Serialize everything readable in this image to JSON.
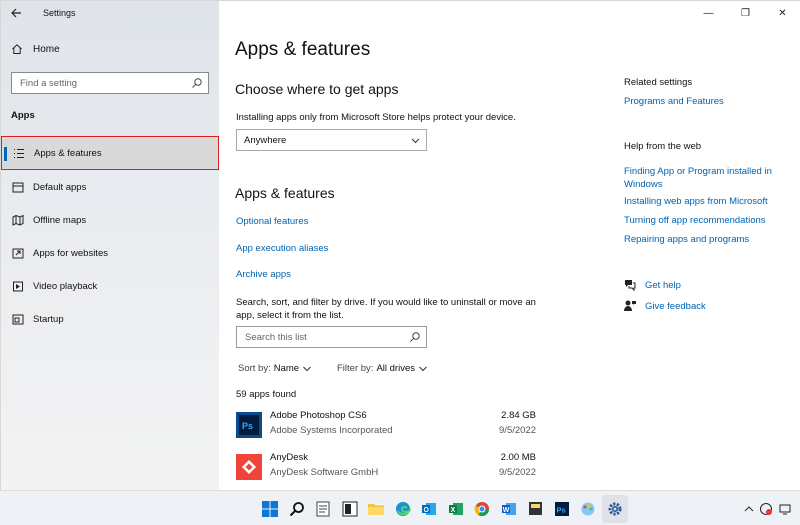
{
  "window": {
    "title": "Settings",
    "controls": {
      "minimize": "—",
      "maximize": "❐",
      "close": "✕"
    }
  },
  "sidebar": {
    "home_label": "Home",
    "search_placeholder": "Find a setting",
    "section_label": "Apps",
    "items": [
      {
        "label": "Apps & features",
        "icon": "list-icon",
        "active": true
      },
      {
        "label": "Default apps",
        "icon": "default-apps-icon",
        "active": false
      },
      {
        "label": "Offline maps",
        "icon": "map-icon",
        "active": false
      },
      {
        "label": "Apps for websites",
        "icon": "link-window-icon",
        "active": false
      },
      {
        "label": "Video playback",
        "icon": "video-icon",
        "active": false
      },
      {
        "label": "Startup",
        "icon": "startup-icon",
        "active": false
      }
    ]
  },
  "main": {
    "title": "Apps & features",
    "choose_heading": "Choose where to get apps",
    "store_note": "Installing apps only from Microsoft Store helps protect your device.",
    "source_dropdown": "Anywhere",
    "apps_heading": "Apps & features",
    "links": [
      "Optional features",
      "App execution aliases",
      "Archive apps"
    ],
    "search_help": "Search, sort, and filter by drive. If you would like to uninstall or move an app, select it from the list.",
    "list_search_placeholder": "Search this list",
    "sort_label": "Sort by:",
    "sort_value": "Name",
    "filter_label": "Filter by:",
    "filter_value": "All drives",
    "count_text": "59 apps found",
    "apps": [
      {
        "name": "Adobe Photoshop CS6",
        "publisher": "Adobe Systems Incorporated",
        "size": "2.84 GB",
        "date": "9/5/2022",
        "icon": "photoshop-icon"
      },
      {
        "name": "AnyDesk",
        "publisher": "AnyDesk Software GmbH",
        "size": "2.00 MB",
        "date": "9/5/2022",
        "icon": "anydesk-icon"
      }
    ]
  },
  "related": {
    "heading": "Related settings",
    "programs_link": "Programs and Features",
    "help_heading": "Help from the web",
    "help_links": [
      "Finding App or Program installed in Windows",
      "Installing web apps from Microsoft",
      "Turning off app recommendations",
      "Repairing apps and programs"
    ],
    "get_help": "Get help",
    "give_feedback": "Give feedback"
  },
  "colors": {
    "accent": "#0067c0",
    "link": "#0063b1",
    "highlight_border": "#e02020"
  },
  "taskbar": {
    "icons": [
      "windows-start-icon",
      "search-icon",
      "file-icon",
      "task-view-icon",
      "file-explorer-icon",
      "edge-icon",
      "outlook-icon",
      "excel-icon",
      "chrome-icon",
      "word-icon",
      "sticky-icon",
      "photoshop-icon",
      "paint-icon",
      "settings-icon"
    ]
  }
}
